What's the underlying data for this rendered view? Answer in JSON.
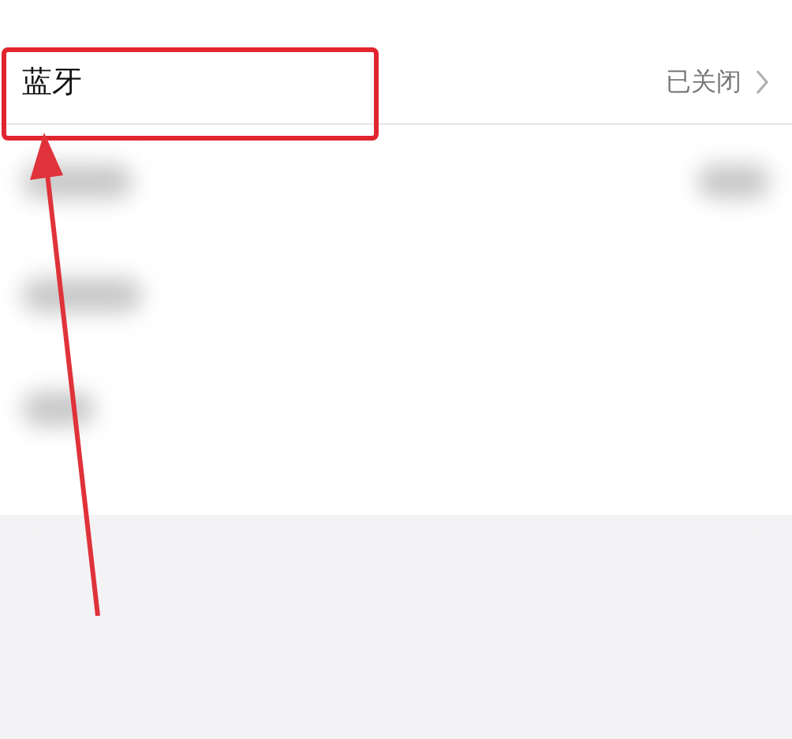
{
  "settings_row": {
    "label": "蓝牙",
    "status": "已关闭"
  }
}
